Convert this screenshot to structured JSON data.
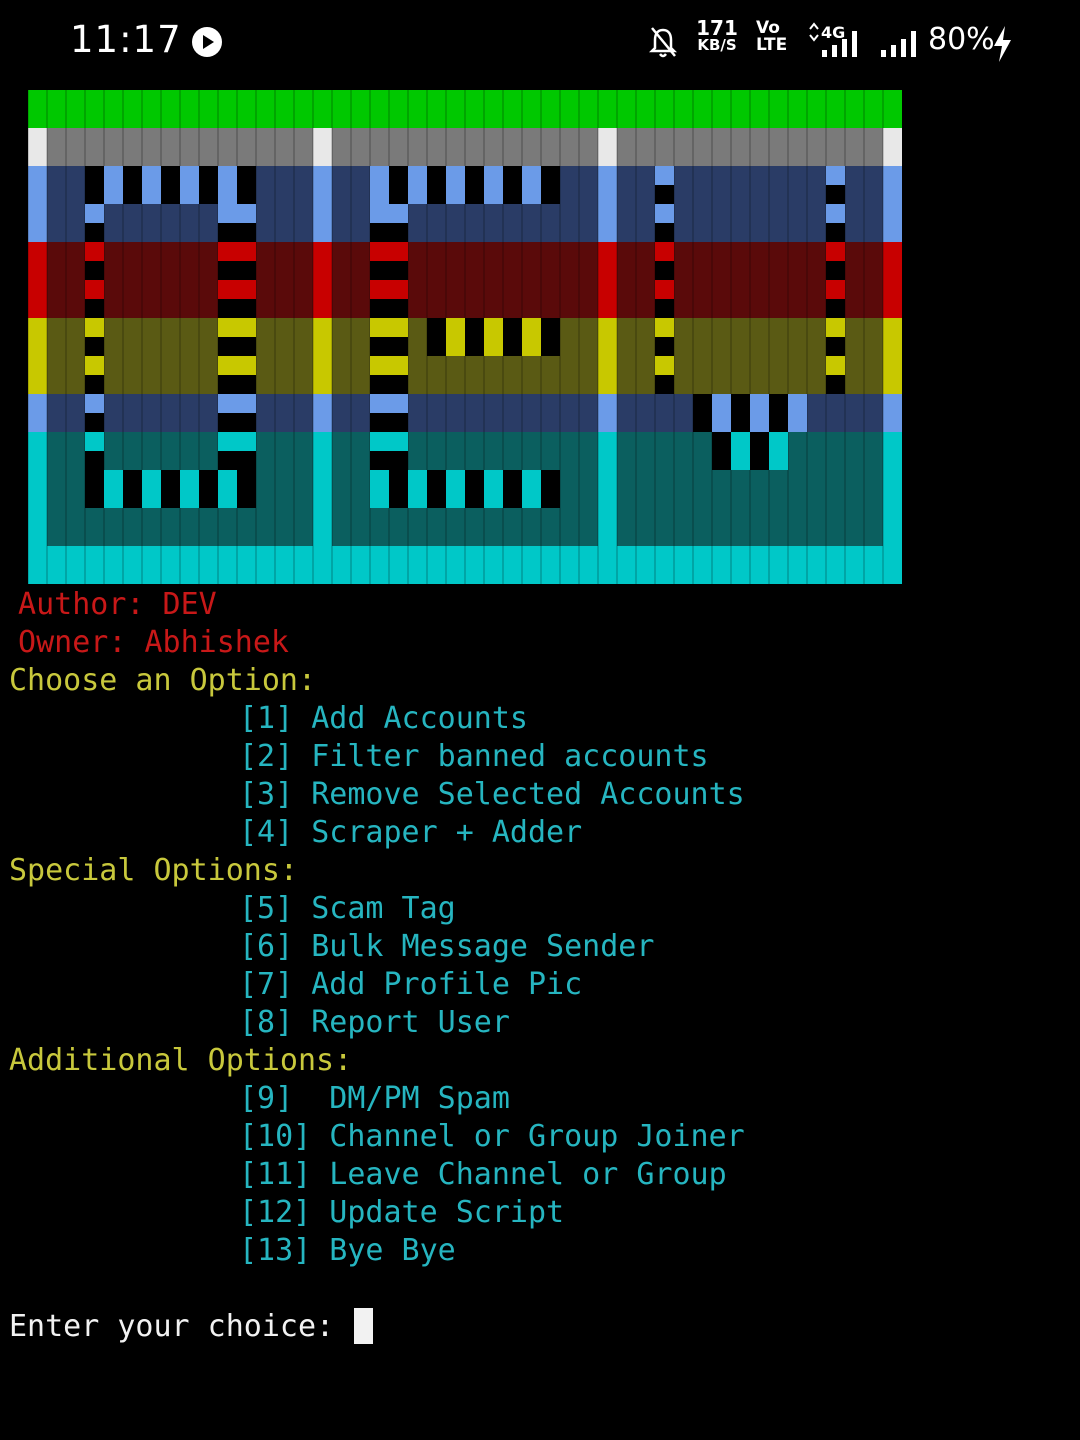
{
  "status_bar": {
    "time": "11:17",
    "net_speed_value": "171",
    "net_speed_unit": "KB/S",
    "volte_top": "Vo",
    "volte_bottom": "LTE",
    "network": "4G",
    "battery": "80%",
    "icons": [
      "play-icon",
      "mute-bell-icon",
      "signal-icon",
      "signal-icon",
      "charging-bolt-icon"
    ]
  },
  "banner": {
    "stripe_colors": [
      "#00c800",
      "#e8e8e8",
      "#6b9be8",
      "#c80000",
      "#c8c800",
      "#6b9be8",
      "#00c8c8"
    ],
    "letters": "ASCII art logo (blocky letters)"
  },
  "header": {
    "author": " Author: DEV",
    "owner": " Owner: Abhishek"
  },
  "menu": {
    "sections": [
      {
        "title": "Choose an Option:",
        "items": [
          "[1] Add Accounts",
          "[2] Filter banned accounts",
          "[3] Remove Selected Accounts",
          "[4] Scraper + Adder"
        ]
      },
      {
        "title": "Special Options:",
        "items": [
          "[5] Scam Tag",
          "[6] Bulk Message Sender",
          "[7] Add Profile Pic",
          "[8] Report User"
        ]
      },
      {
        "title": "Additional Options:",
        "items": [
          "[9]  DM/PM Spam",
          "[10] Channel or Group Joiner",
          "[11] Leave Channel or Group",
          "[12] Update Script",
          "[13] Bye Bye"
        ]
      }
    ]
  },
  "prompt": {
    "label": "Enter your choice: "
  },
  "colors": {
    "author": "#c81818",
    "section_title": "#c8c83c",
    "menu_item": "#26b5c0",
    "prompt": "#f2f2f2",
    "background": "#000000"
  }
}
